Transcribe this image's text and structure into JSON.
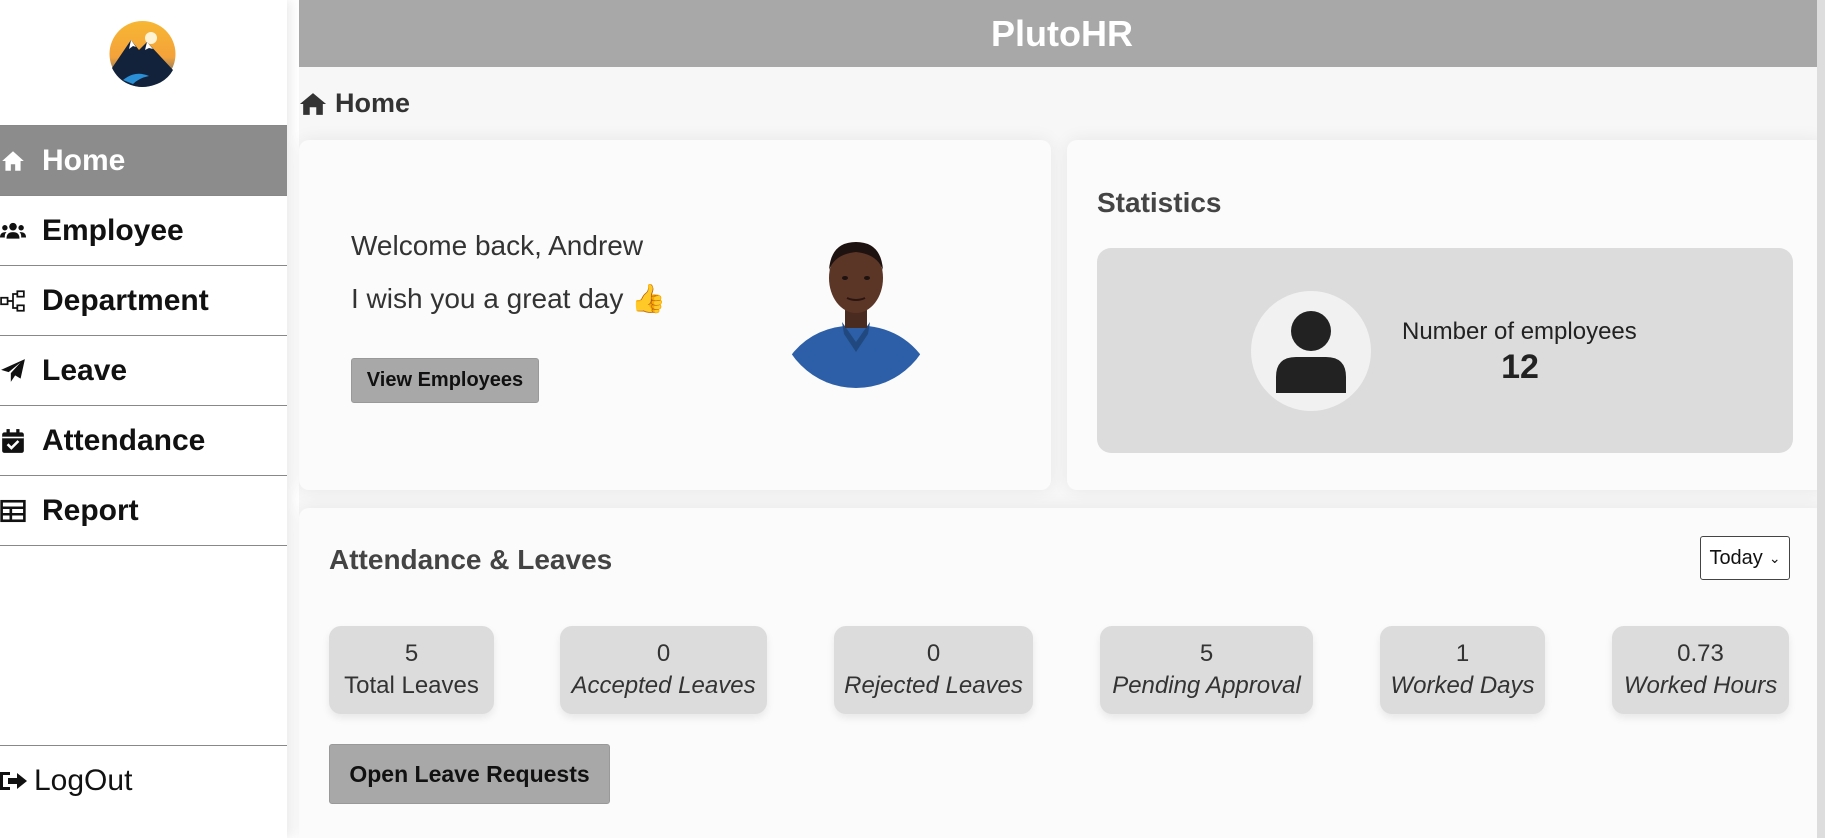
{
  "app": {
    "title": "PlutoHR"
  },
  "sidebar": {
    "items": [
      {
        "label": "Home",
        "icon": "home-icon"
      },
      {
        "label": "Employee",
        "icon": "users-icon"
      },
      {
        "label": "Department",
        "icon": "sitemap-icon"
      },
      {
        "label": "Leave",
        "icon": "paper-plane-icon"
      },
      {
        "label": "Attendance",
        "icon": "calendar-check-icon"
      },
      {
        "label": "Report",
        "icon": "table-icon"
      }
    ],
    "active": "Home",
    "logout_label": "LogOut"
  },
  "breadcrumb": {
    "label": "Home"
  },
  "welcome": {
    "greeting": "Welcome back, Andrew",
    "wish": "I wish you a great day 👍",
    "button": "View Employees"
  },
  "stats": {
    "title": "Statistics",
    "label": "Number of employees",
    "value": "12"
  },
  "attendance": {
    "title": "Attendance & Leaves",
    "period": "Today",
    "metrics": [
      {
        "value": "5",
        "label": "Total Leaves"
      },
      {
        "value": "0",
        "label": "Accepted Leaves"
      },
      {
        "value": "0",
        "label": "Rejected Leaves"
      },
      {
        "value": "5",
        "label": "Pending Approval"
      },
      {
        "value": "1",
        "label": "Worked Days"
      },
      {
        "value": "0.73",
        "label": "Worked Hours"
      }
    ],
    "open_button": "Open Leave Requests"
  },
  "colors": {
    "header": "#a9a8a9",
    "active_nav": "#8c8c8c",
    "card": "#fbfbfb",
    "stat_box": "#dcdcdc"
  }
}
